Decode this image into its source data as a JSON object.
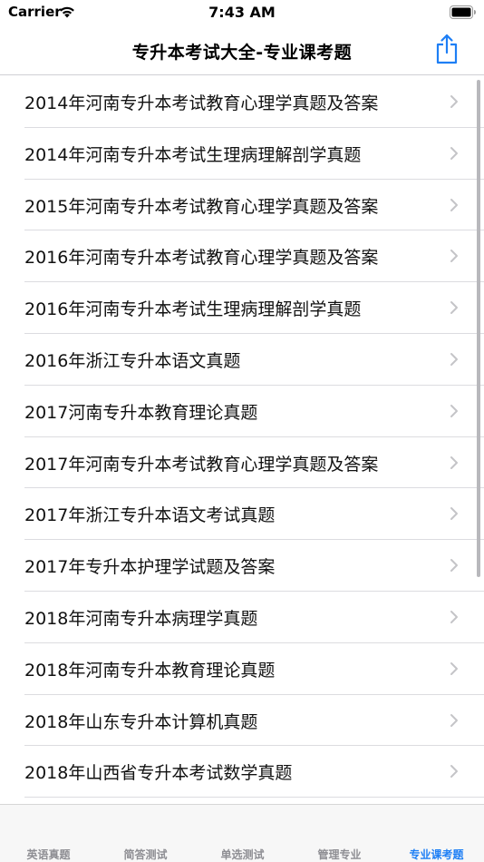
{
  "status_bar": {
    "carrier": "Carrier",
    "time": "7:43 AM"
  },
  "nav": {
    "title": "专升本考试大全-专业课考题",
    "share_icon": "share-icon"
  },
  "list_items": [
    "2014年河南专升本考试教育心理学真题及答案",
    "2014年河南专升本考试生理病理解剖学真题",
    "2015年河南专升本考试教育心理学真题及答案",
    "2016年河南专升本考试教育心理学真题及答案",
    "2016年河南专升本考试生理病理解剖学真题",
    "2016年浙江专升本语文真题",
    "2017河南专升本教育理论真题",
    "2017年河南专升本考试教育心理学真题及答案",
    "2017年浙江专升本语文考试真题",
    "2017年专升本护理学试题及答案",
    "2018年河南专升本病理学真题",
    "2018年河南专升本教育理论真题",
    "2018年山东专升本计算机真题",
    "2018年山西省专升本考试数学真题"
  ],
  "tabs": [
    {
      "label": "英语真题",
      "active": false
    },
    {
      "label": "简答测试",
      "active": false
    },
    {
      "label": "单选测试",
      "active": false
    },
    {
      "label": "管理专业",
      "active": false
    },
    {
      "label": "专业课考题",
      "active": true
    }
  ],
  "colors": {
    "accent": "#1e7ff5",
    "tab_inactive": "#8e8e93",
    "chevron": "#c4c4c7"
  }
}
